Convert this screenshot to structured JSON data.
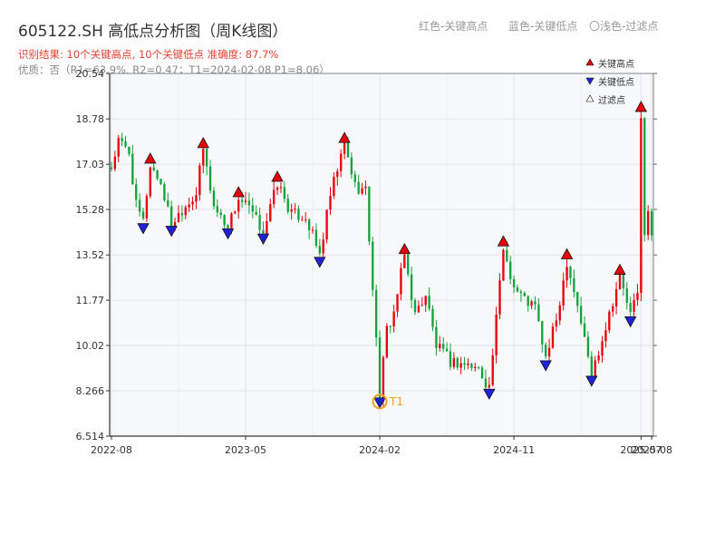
{
  "title": "605122.SH 高低点分析图（周K线图）",
  "subtitle": "识别结果: 10个关键高点, 10个关键低点   准确度: 87.7%",
  "subtitle2": "优质：否（R1=63.9%, R2=0.47；T1=2024-02-08,P1=8.06）",
  "header_legend": {
    "red": "红色-关键高点",
    "blue": "蓝色-关键低点",
    "light": "〇浅色-过滤点"
  },
  "colors": {
    "up": "#e8000b",
    "down": "#14a23c",
    "high_marker": "#e8000b",
    "low_marker": "#1f22d6",
    "t1": "#f0a020",
    "axis": "#333333",
    "plot_bg": "#f6f8fa"
  },
  "chart_data": {
    "type": "candlestick",
    "ylim": [
      6.514,
      20.54
    ],
    "yticks": [
      "20.54",
      "18.78",
      "17.03",
      "15.28",
      "13.52",
      "11.77",
      "10.02",
      "8.266",
      "6.514"
    ],
    "ytick_values": [
      20.54,
      18.78,
      17.03,
      15.28,
      13.52,
      11.77,
      10.02,
      8.266,
      6.514
    ],
    "xticks": [
      "2022-08",
      "2023-05",
      "2024-02",
      "2024-11",
      "2025-07",
      "2025-08"
    ],
    "xtick_values": [
      0,
      38,
      76,
      114,
      150,
      153
    ],
    "n_weeks": 154,
    "legend": [
      {
        "key": "high",
        "label": "关键高点"
      },
      {
        "key": "low",
        "label": "关键低点"
      },
      {
        "key": "filtered",
        "label": "过滤点"
      }
    ],
    "key_highs": [
      {
        "week": 11,
        "price": 17.0
      },
      {
        "week": 26,
        "price": 17.6
      },
      {
        "week": 36,
        "price": 15.7
      },
      {
        "week": 47,
        "price": 16.3
      },
      {
        "week": 66,
        "price": 17.8
      },
      {
        "week": 83,
        "price": 13.5
      },
      {
        "week": 111,
        "price": 13.8
      },
      {
        "week": 129,
        "price": 13.3
      },
      {
        "week": 144,
        "price": 12.7
      },
      {
        "week": 150,
        "price": 19.0
      }
    ],
    "key_lows": [
      {
        "week": 9,
        "price": 14.8
      },
      {
        "week": 17,
        "price": 14.7
      },
      {
        "week": 33,
        "price": 14.6
      },
      {
        "week": 43,
        "price": 14.4
      },
      {
        "week": 59,
        "price": 13.5
      },
      {
        "week": 76,
        "price": 8.06
      },
      {
        "week": 107,
        "price": 8.4
      },
      {
        "week": 123,
        "price": 9.5
      },
      {
        "week": 136,
        "price": 8.9
      },
      {
        "week": 147,
        "price": 11.2
      }
    ],
    "t1_point": {
      "week": 76,
      "price": 8.06,
      "label": "T1"
    }
  }
}
